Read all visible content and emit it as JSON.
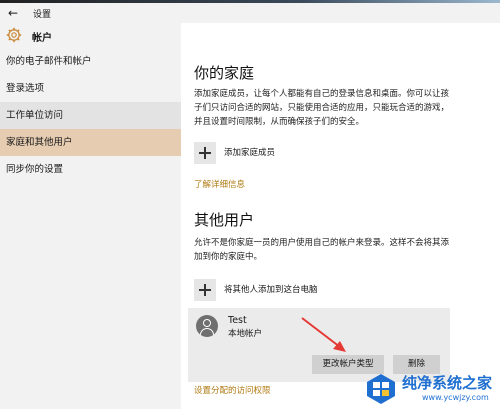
{
  "window": {
    "back_glyph": "←",
    "title": "设置"
  },
  "sidebar": {
    "header": {
      "icon": "gear-icon",
      "title": "帐户"
    },
    "items": [
      {
        "label": "你的电子邮件和帐户"
      },
      {
        "label": "登录选项"
      },
      {
        "label": "工作单位访问"
      },
      {
        "label": "家庭和其他用户",
        "selected": true
      },
      {
        "label": "同步你的设置"
      }
    ]
  },
  "family": {
    "heading": "你的家庭",
    "description": "添加家庭成员，让每个人都能有自己的登录信息和桌面。你可以让孩子们只访问合适的网站，只能使用合适的应用，只能玩合适的游戏，并且设置时间限制，从而确保孩子们的安全。",
    "add_label": "添加家庭成员",
    "learn_more": "了解详细信息"
  },
  "others": {
    "heading": "其他用户",
    "description": "允许不是你家庭一员的用户使用自己的帐户来登录。这样不会将其添加到你的家庭中。",
    "add_label": "将其他人添加到这台电脑",
    "user": {
      "name": "Test",
      "type": "本地帐户",
      "change_type_button": "更改帐户类型",
      "remove_button": "删除"
    },
    "assigned_access": "设置分配的访问权限"
  },
  "colors": {
    "accent_link": "#b07a12",
    "selected_item": "#e6cdb1",
    "annotation_arrow": "#e53935"
  },
  "watermark": {
    "name": "纯净系统之家",
    "url": "www.ycwjzy.com"
  }
}
